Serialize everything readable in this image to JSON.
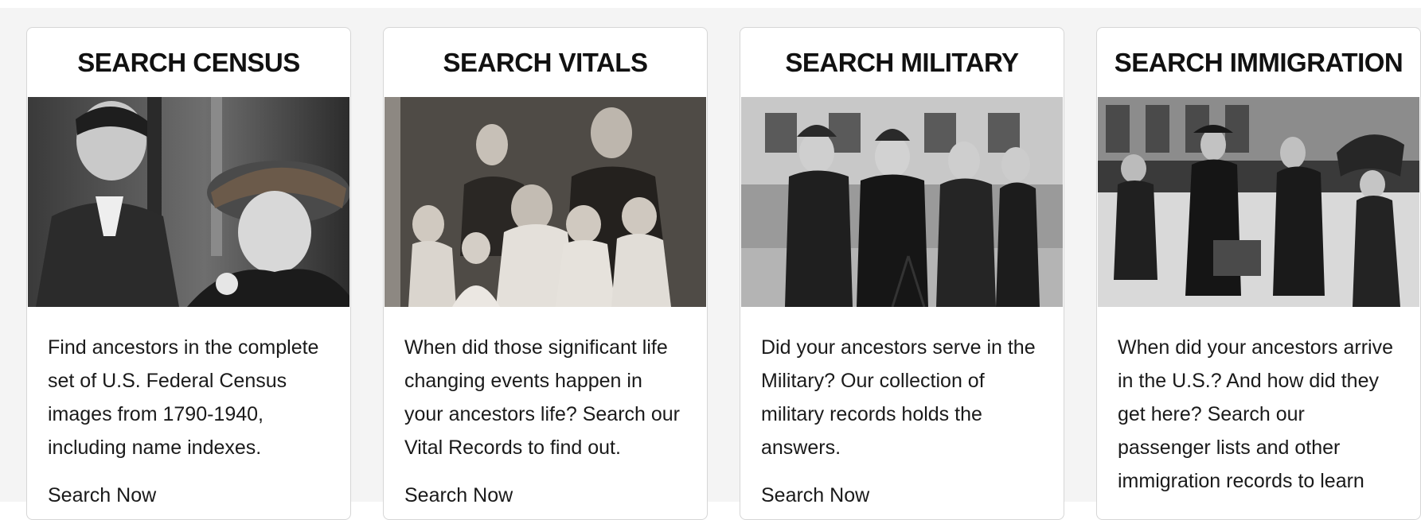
{
  "cards": [
    {
      "title": "SEARCH CENSUS",
      "image": "census-photo-couple",
      "description": "Find ancestors in the complete set of U.S. Federal Census images from 1790-1940, including name indexes.",
      "link_text": "Search Now"
    },
    {
      "title": "SEARCH VITALS",
      "image": "vitals-photo-family",
      "description": "When did those significant life changing events happen in your ancestors life? Search our Vital Records to find out.",
      "link_text": "Search Now"
    },
    {
      "title": "SEARCH MILITARY",
      "image": "military-photo-officers",
      "description": "Did your ancestors serve in the Military? Our collection of military records holds the answers.",
      "link_text": "Search Now"
    },
    {
      "title": "SEARCH IMMIGRATION",
      "image": "immigration-photo-travelers",
      "description": "When did your ancestors arrive in the U.S.? And how did they get here? Search our passenger lists and other immigration records to learn"
    }
  ]
}
